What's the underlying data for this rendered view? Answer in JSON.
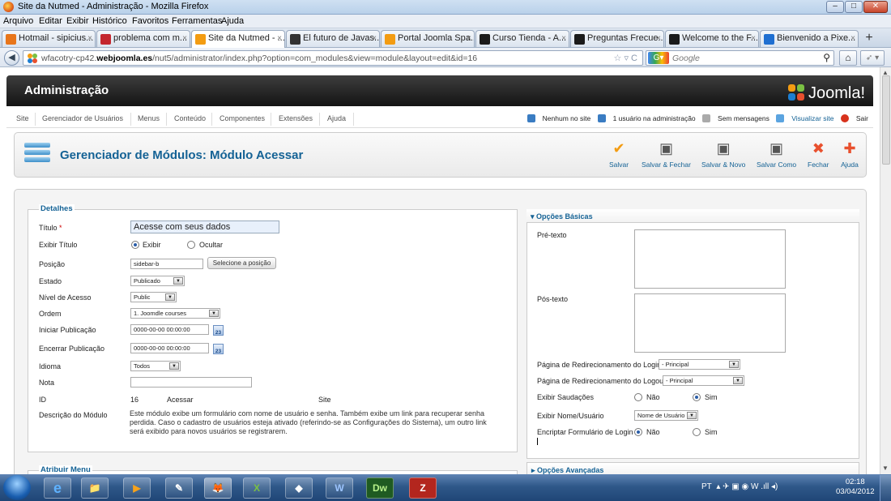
{
  "window": {
    "title": "Site da Nutmed - Administração - Mozilla Firefox",
    "min": "–",
    "max": "□",
    "close": "✕"
  },
  "menubar": [
    "Arquivo",
    "Editar",
    "Exibir",
    "Histórico",
    "Favoritos",
    "Ferramentas",
    "Ajuda"
  ],
  "tabs": [
    {
      "label": "Hotmail - sipicius...",
      "color": "#e8751a"
    },
    {
      "label": "problema com m...",
      "color": "#c4262e"
    },
    {
      "label": "Site da Nutmed - ...",
      "color": "#f39c12"
    },
    {
      "label": "El futuro de Javas...",
      "color": "#333333"
    },
    {
      "label": "Portal Joomla Spa...",
      "color": "#f39c12"
    },
    {
      "label": "Curso Tienda - A...",
      "color": "#1b1b1b"
    },
    {
      "label": "Preguntas Frecue...",
      "color": "#1b1b1b"
    },
    {
      "label": "Welcome to the F...",
      "color": "#1b1b1b"
    },
    {
      "label": "Bienvenido a Pixe...",
      "color": "#1f6fd1"
    }
  ],
  "tab_close": "×",
  "new_tab": "+",
  "nav": {
    "back": "◀",
    "url_prefix": "wfacotry-cp42.",
    "url_domain": "webjoomla.es",
    "url_rest": "/nut5/administrator/index.php?option=com_modules&view=module&layout=edit&id=16",
    "url_icons": "☆ ▿ C",
    "search_engine": "Google",
    "search_placeholder": "Google",
    "search_icon": "⚲",
    "home": "⌂",
    "addon": "➶ ▾"
  },
  "joomla": {
    "header_title": "Administração",
    "logo": "Joomla!",
    "menu": [
      "Site",
      "Gerenciador de Usuários",
      "Menus",
      "Conteúdo",
      "Componentes",
      "Extensões",
      "Ajuda"
    ],
    "status": {
      "no_site": "Nenhum no site",
      "admin_users": "1 usuário na administração",
      "messages": "Sem mensagens",
      "view_site": "Visualizar site",
      "logout": "Sair"
    },
    "page_title": "Gerenciador de Módulos: Módulo Acessar",
    "toolbar": [
      {
        "label": "Salvar",
        "icon": "check-icon",
        "glyph": "✔",
        "color": "#f39c12"
      },
      {
        "label": "Salvar & Fechar",
        "icon": "save-close-icon",
        "glyph": "▣",
        "color": "#555555"
      },
      {
        "label": "Salvar & Novo",
        "icon": "save-new-icon",
        "glyph": "▣",
        "color": "#555555"
      },
      {
        "label": "Salvar Como",
        "icon": "save-copy-icon",
        "glyph": "▣",
        "color": "#555555"
      },
      {
        "label": "Fechar",
        "icon": "close-icon",
        "glyph": "✖",
        "color": "#e8502e"
      },
      {
        "label": "Ajuda",
        "icon": "help-icon",
        "glyph": "✚",
        "color": "#e8502e"
      }
    ]
  },
  "details": {
    "legend": "Detalhes",
    "title_label": "Título",
    "required_mark": "*",
    "title_value": "Acesse com seus dados",
    "show_title_label": "Exibir Título",
    "show_title_yes": "Exibir",
    "show_title_no": "Ocultar",
    "position_label": "Posição",
    "position_value": "sidebar-b",
    "position_button": "Selecione a posição",
    "state_label": "Estado",
    "state_value": "Publicado",
    "access_label": "Nível de Acesso",
    "access_value": "Public",
    "order_label": "Ordem",
    "order_value": "1. Joomdle courses",
    "publish_up_label": "Iniciar Publicação",
    "publish_up_value": "0000-00-00 00:00:00",
    "publish_down_label": "Encerrar Publicação",
    "publish_down_value": "0000-00-00 00:00:00",
    "calendar_day": "23",
    "language_label": "Idioma",
    "language_value": "Todos",
    "note_label": "Nota",
    "note_value": "",
    "id_label": "ID",
    "id_value": "16",
    "module_name": "Acessar",
    "client": "Site",
    "desc_label": "Descrição do Módulo",
    "desc_text": "Este módulo exibe um formulário com nome de usuário e senha. Também exibe um link para recuperar senha perdida. Caso o cadastro de usuários esteja ativado (referindo-se as Configurações do Sistema), um outro link será exibido para novos usuários se registrarem.",
    "menu_legend": "Atribuir Menu"
  },
  "basic_options": {
    "header": "Opções Básicas",
    "pretext_label": "Pré-texto",
    "posttext_label": "Pós-texto",
    "login_redirect_label": "Página de Redirecionamento do Login",
    "login_redirect_value": "- Principal",
    "logout_redirect_label": "Página de Redirecionamento do Logout",
    "logout_redirect_value": "- Principal",
    "greeting_label": "Exibir Saudações",
    "greeting_no": "Não",
    "greeting_yes": "Sim",
    "name_label": "Exibir Nome/Usuário",
    "name_value": "Nome de Usuário",
    "encrypt_label": "Encriptar Formulário de Login",
    "encrypt_no": "Não",
    "encrypt_yes": "Sim",
    "advanced_header": "Opções Avançadas"
  },
  "taskbar": {
    "items": [
      "e",
      "📁",
      "▶",
      "✎",
      "🦊",
      "X",
      "◆",
      "W",
      "Dw",
      "Z"
    ],
    "tray_lang": "PT",
    "tray_icons": "▴ ✈ ▣ ◉ W .ıll ◂)",
    "time": "02:18",
    "date": "03/04/2012"
  }
}
